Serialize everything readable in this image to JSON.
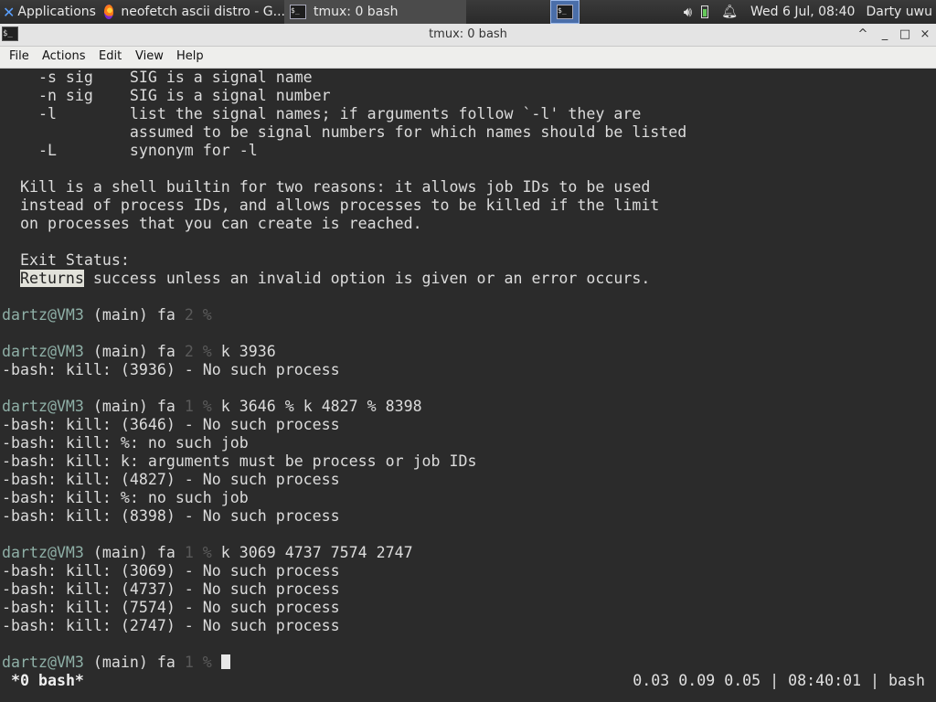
{
  "panel": {
    "apps_label": "Applications",
    "task_firefox": "neofetch ascii distro - G...",
    "task_tmux": "tmux: 0 bash",
    "clock": "Wed  6 Jul, 08:40",
    "user": "Darty uwu",
    "icons": [
      "xfce-icon",
      "firefox-icon",
      "terminal-icon",
      "volume-icon",
      "battery-icon",
      "bell-icon"
    ]
  },
  "window": {
    "title": "tmux: 0 bash",
    "controls": [
      "^",
      "_",
      "□",
      "×"
    ]
  },
  "menu": [
    "File",
    "Actions",
    "Edit",
    "View",
    "Help"
  ],
  "terminal": {
    "help_lines": [
      "    -s sig    SIG is a signal name",
      "    -n sig    SIG is a signal number",
      "    -l        list the signal names; if arguments follow `-l' they are",
      "              assumed to be signal numbers for which names should be listed",
      "    -L        synonym for -l",
      "",
      "  Kill is a shell builtin for two reasons: it allows job IDs to be used",
      "  instead of process IDs, and allows processes to be killed if the limit",
      "  on processes that you can create is reached.",
      "",
      "  Exit Status:"
    ],
    "exit_status": {
      "highlight": "Returns",
      "rest": " success unless an invalid option is given or an error occurs."
    },
    "prompt": {
      "user_host": "dartz@VM3",
      "mid": " (main) fa "
    },
    "blocks": [
      {
        "num": "2 %",
        "cmd": "",
        "output": []
      },
      {
        "num": "2 %",
        "cmd": " k 3936",
        "output": [
          "-bash: kill: (3936) - No such process"
        ]
      },
      {
        "num": "1 %",
        "cmd": " k 3646 % k 4827 % 8398",
        "output": [
          "-bash: kill: (3646) - No such process",
          "-bash: kill: %: no such job",
          "-bash: kill: k: arguments must be process or job IDs",
          "-bash: kill: (4827) - No such process",
          "-bash: kill: %: no such job",
          "-bash: kill: (8398) - No such process"
        ]
      },
      {
        "num": "1 %",
        "cmd": " k 3069 4737 7574 2747",
        "output": [
          "-bash: kill: (3069) - No such process",
          "-bash: kill: (4737) - No such process",
          "-bash: kill: (7574) - No such process",
          "-bash: kill: (2747) - No such process"
        ]
      },
      {
        "num": "1 %",
        "cmd": " ",
        "output": []
      }
    ]
  },
  "status": {
    "left": "*0 bash*",
    "right": "0.03 0.09 0.05 | 08:40:01 | bash"
  }
}
